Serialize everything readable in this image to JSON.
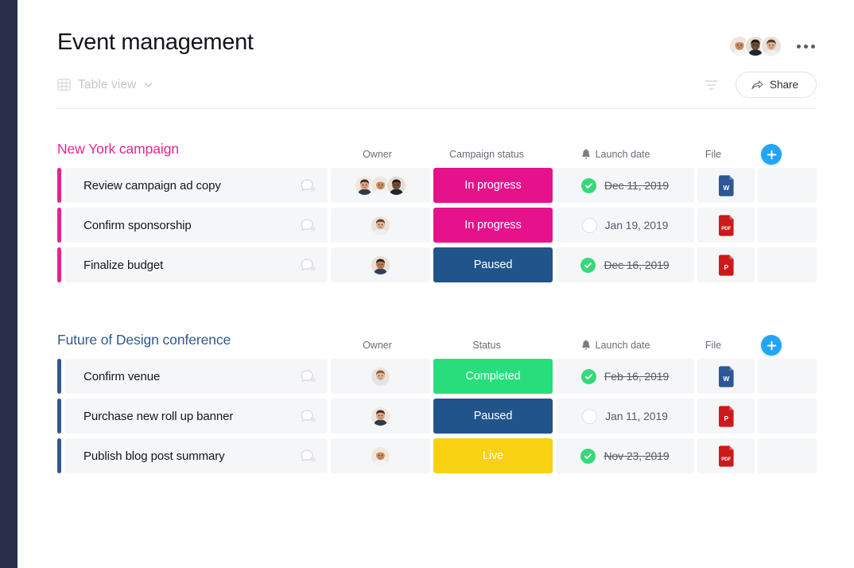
{
  "header": {
    "title": "Event management",
    "avatars_count": 3,
    "more_menu": "more-options",
    "colors": {
      "rail": "#2b2e4a",
      "accent_blue": "#22a5f7"
    }
  },
  "toolbar": {
    "view_label": "Table view",
    "view_icon": "table-grid-icon",
    "chevron_icon": "chevron-down-icon",
    "filter_icon": "filter-icon",
    "share_label": "Share",
    "share_icon": "share-arrow-icon"
  },
  "groups": [
    {
      "title": "New York campaign",
      "color": "#e5258f",
      "columns": {
        "owner": "Owner",
        "status": "Campaign status",
        "date": "Launch date",
        "date_icon": "bell-icon",
        "file": "File",
        "add": "add-item-button"
      },
      "rows": [
        {
          "name": "Review campaign ad copy",
          "comment_icon": "comment-bubble-icon",
          "owners": 3,
          "status": "In progress",
          "status_color": "#e5128c",
          "date": "Dec 11, 2019",
          "date_done": true,
          "file": "W",
          "file_type": "word"
        },
        {
          "name": "Confirm sponsorship",
          "comment_icon": "comment-bubble-icon",
          "owners": 1,
          "status": "In progress",
          "status_color": "#e5128c",
          "date": "Jan 19, 2019",
          "date_done": false,
          "file": "PDF",
          "file_type": "pdf"
        },
        {
          "name": "Finalize budget",
          "comment_icon": "comment-bubble-icon",
          "owners": 1,
          "status": "Paused",
          "status_color": "#21548a",
          "date": "Dec 16, 2019",
          "date_done": true,
          "file": "P",
          "file_type": "powerpoint"
        }
      ]
    },
    {
      "title": "Future of Design conference",
      "color": "#2e5a8e",
      "columns": {
        "owner": "Owner",
        "status": "Status",
        "date": "Launch date",
        "date_icon": "bell-icon",
        "file": "File",
        "add": "add-item-button"
      },
      "rows": [
        {
          "name": "Confirm venue",
          "comment_icon": "comment-bubble-icon",
          "owners": 1,
          "status": "Completed",
          "status_color": "#28de7c",
          "date": "Feb 16, 2019",
          "date_done": true,
          "file": "W",
          "file_type": "word"
        },
        {
          "name": "Purchase new roll up banner",
          "comment_icon": "comment-bubble-icon",
          "owners": 1,
          "status": "Paused",
          "status_color": "#21548a",
          "date": "Jan 11, 2019",
          "date_done": false,
          "file": "P",
          "file_type": "powerpoint"
        },
        {
          "name": "Publish blog post summary",
          "comment_icon": "comment-bubble-icon",
          "owners": 1,
          "status": "Live",
          "status_color": "#f8d113",
          "date": "Nov 23, 2019",
          "date_done": true,
          "file": "PDF",
          "file_type": "pdf"
        }
      ]
    }
  ]
}
